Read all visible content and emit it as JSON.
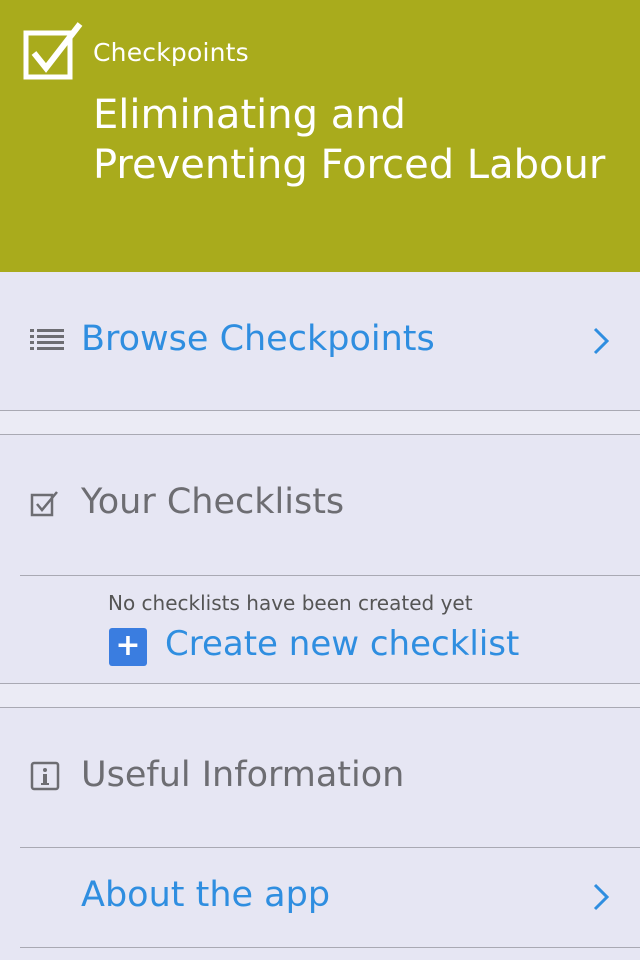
{
  "header": {
    "app_name": "Checkpoints",
    "title_line1": "Eliminating and",
    "title_line2": "Preventing Forced Labour",
    "logo_icon": "checkbox-checked-icon",
    "background_color": "#a9ab1c"
  },
  "browse": {
    "label": "Browse Checkpoints",
    "icon": "list-icon",
    "chevron_icon": "chevron-right-icon"
  },
  "checklists": {
    "section_label": "Your Checklists",
    "icon": "checkbox-icon",
    "empty_message": "No checklists have been created yet",
    "create_label": "Create new checklist",
    "create_icon": "plus-icon"
  },
  "info": {
    "section_label": "Useful Information",
    "icon": "info-icon",
    "about_label": "About the app",
    "chevron_icon": "chevron-right-icon"
  },
  "colors": {
    "accent": "#2f8ee0",
    "section_text": "#6d6d72",
    "background": "#e6e6f3"
  }
}
